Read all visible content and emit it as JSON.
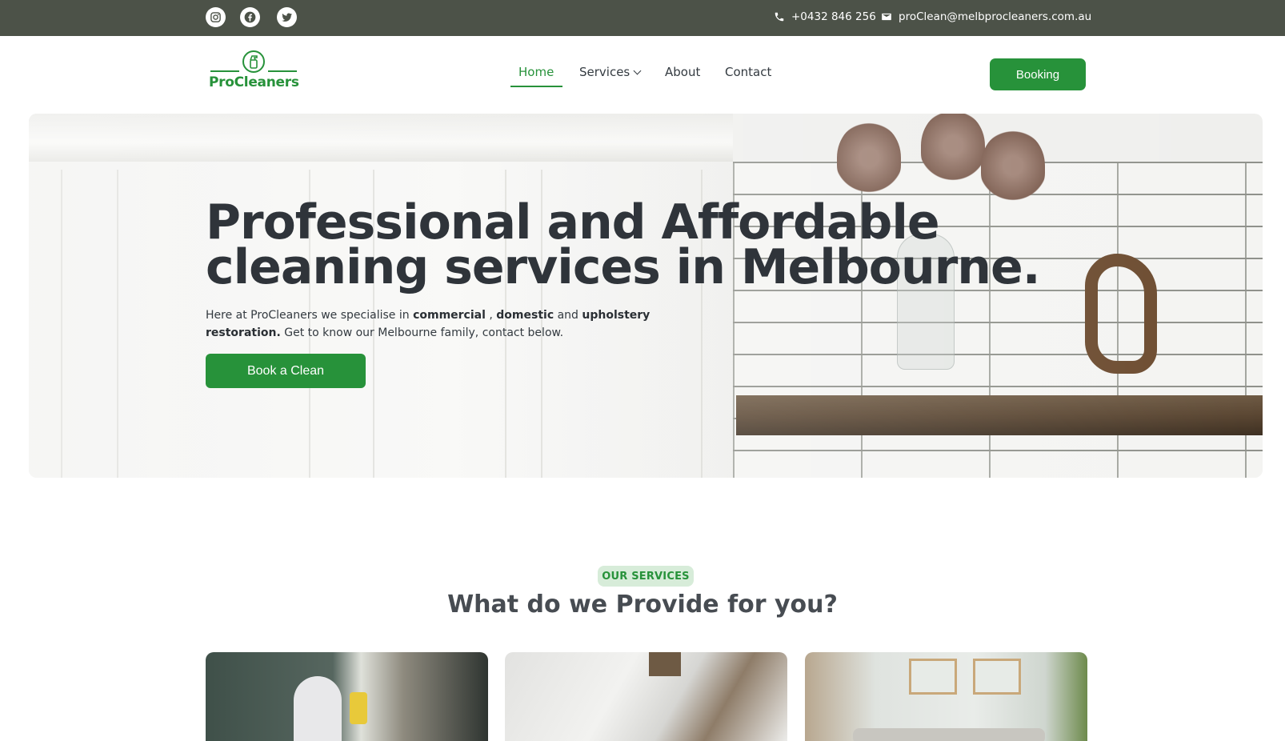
{
  "topbar": {
    "phone": "+0432 846 256",
    "email": "proClean@melbprocleaners.com.au",
    "social": [
      "instagram-icon",
      "facebook-icon",
      "twitter-icon"
    ]
  },
  "header": {
    "logo_text": "ProCleaners",
    "nav": [
      {
        "label": "Home",
        "active": true
      },
      {
        "label": "Services",
        "has_dropdown": true
      },
      {
        "label": "About"
      },
      {
        "label": "Contact"
      }
    ],
    "booking_label": "Booking"
  },
  "hero": {
    "title_line1": "Professional and Affordable",
    "title_line2": "cleaning services in Melbourne.",
    "text_prefix": "Here at ProCleaners we specialise in ",
    "bold1": "commercial",
    "sep1": " , ",
    "bold2": "domestic",
    "sep2": " and ",
    "bold3": "upholstery restoration.",
    "text_suffix": " Get to know our Melbourne family, contact below.",
    "cta_label": "Book a Clean"
  },
  "services": {
    "badge": "OUR SERVICES",
    "title": "What do we Provide for you?"
  },
  "colors": {
    "brand_green": "#27923a",
    "topbar": "#4c5248",
    "badge_bg": "#d7ecd9"
  }
}
